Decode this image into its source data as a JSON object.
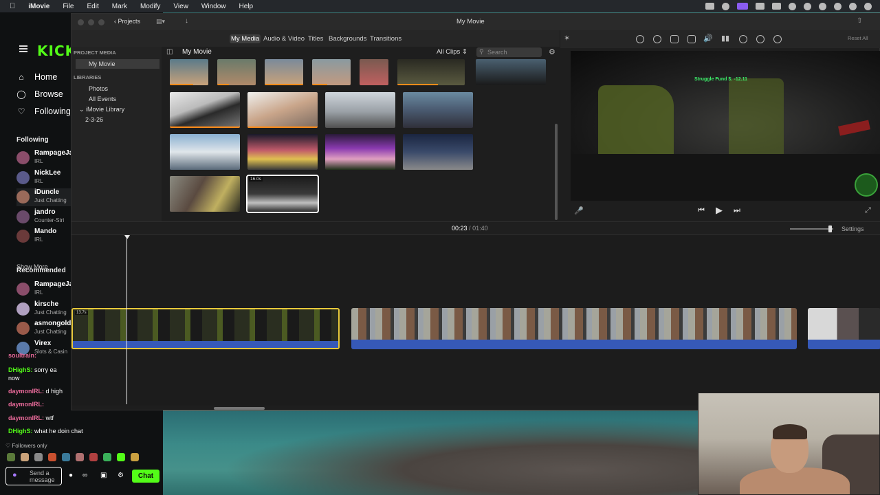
{
  "menubar": {
    "app": "iMovie",
    "items": [
      "File",
      "Edit",
      "Mark",
      "Modify",
      "View",
      "Window",
      "Help"
    ]
  },
  "kick": {
    "logo": "KICK",
    "nav": [
      {
        "label": "Home",
        "icon": "home-icon"
      },
      {
        "label": "Browse",
        "icon": "compass-icon"
      },
      {
        "label": "Following",
        "icon": "heart-icon"
      }
    ],
    "following_title": "Following",
    "following": [
      {
        "name": "RampageJa",
        "cat": "IRL",
        "color": "#8a4d6a"
      },
      {
        "name": "NickLee",
        "cat": "IRL",
        "color": "#5a5a8a"
      },
      {
        "name": "iDuncle",
        "cat": "Just Chatting",
        "color": "#9a6a5a"
      },
      {
        "name": "jandro",
        "cat": "Counter-Stri",
        "color": "#6a4a6a"
      },
      {
        "name": "Mando",
        "cat": "IRL",
        "color": "#6a3a3a"
      }
    ],
    "show_more": "Show More",
    "recommended_title": "Recommended",
    "recommended": [
      {
        "name": "RampageJa",
        "cat": "IRL",
        "color": "#8a4d6a"
      },
      {
        "name": "kirsche",
        "cat": "Just Chatting",
        "color": "#b0a0c0"
      },
      {
        "name": "asmongold",
        "cat": "Just Chatting",
        "color": "#9a5a4a"
      },
      {
        "name": "Virex",
        "cat": "Slots & Casin",
        "color": "#5a7aaa"
      }
    ],
    "chat": [
      {
        "user": "soultrain:",
        "msg": ""
      },
      {
        "user": "DHighS:",
        "msg": "sorry ea"
      },
      {
        "user": "",
        "msg": "now"
      },
      {
        "user": "daymonIRL:",
        "msg": "d high"
      },
      {
        "user": "daymonIRL:",
        "msg": ""
      },
      {
        "user": "daymonIRL:",
        "msg": "wtf"
      },
      {
        "user": "DHighS:",
        "msg": "what he doin chat"
      }
    ],
    "followers_only": "Followers only",
    "send_placeholder": "Send a message",
    "chat_button": "Chat"
  },
  "imovie": {
    "projects_label": "Projects",
    "window_title": "My Movie",
    "tabs": [
      "My Media",
      "Audio & Video",
      "Titles",
      "Backgrounds",
      "Transitions"
    ],
    "project_media_head": "PROJECT MEDIA",
    "libraries_head": "LIBRARIES",
    "library_items": [
      "My Movie",
      "Photos",
      "All Events",
      "iMovie Library",
      "2-3-26"
    ],
    "browser_title": "My Movie",
    "filter": "All Clips",
    "search_placeholder": "Search",
    "selected_clip_duration": "16.0s",
    "reset_all": "Reset All",
    "overlay_text": "Struggle Fund $: -12.11",
    "timecode_current": "00:23",
    "timecode_separator": "/",
    "timecode_total": "01:40",
    "settings": "Settings",
    "timeline_clip_label": "13.7s"
  },
  "colors": {
    "kick_green": "#53fc18",
    "clip_selected_border": "#e8c93a",
    "audio_waveform": "#3659b8",
    "in_use_bar": "#ff8c1a"
  }
}
